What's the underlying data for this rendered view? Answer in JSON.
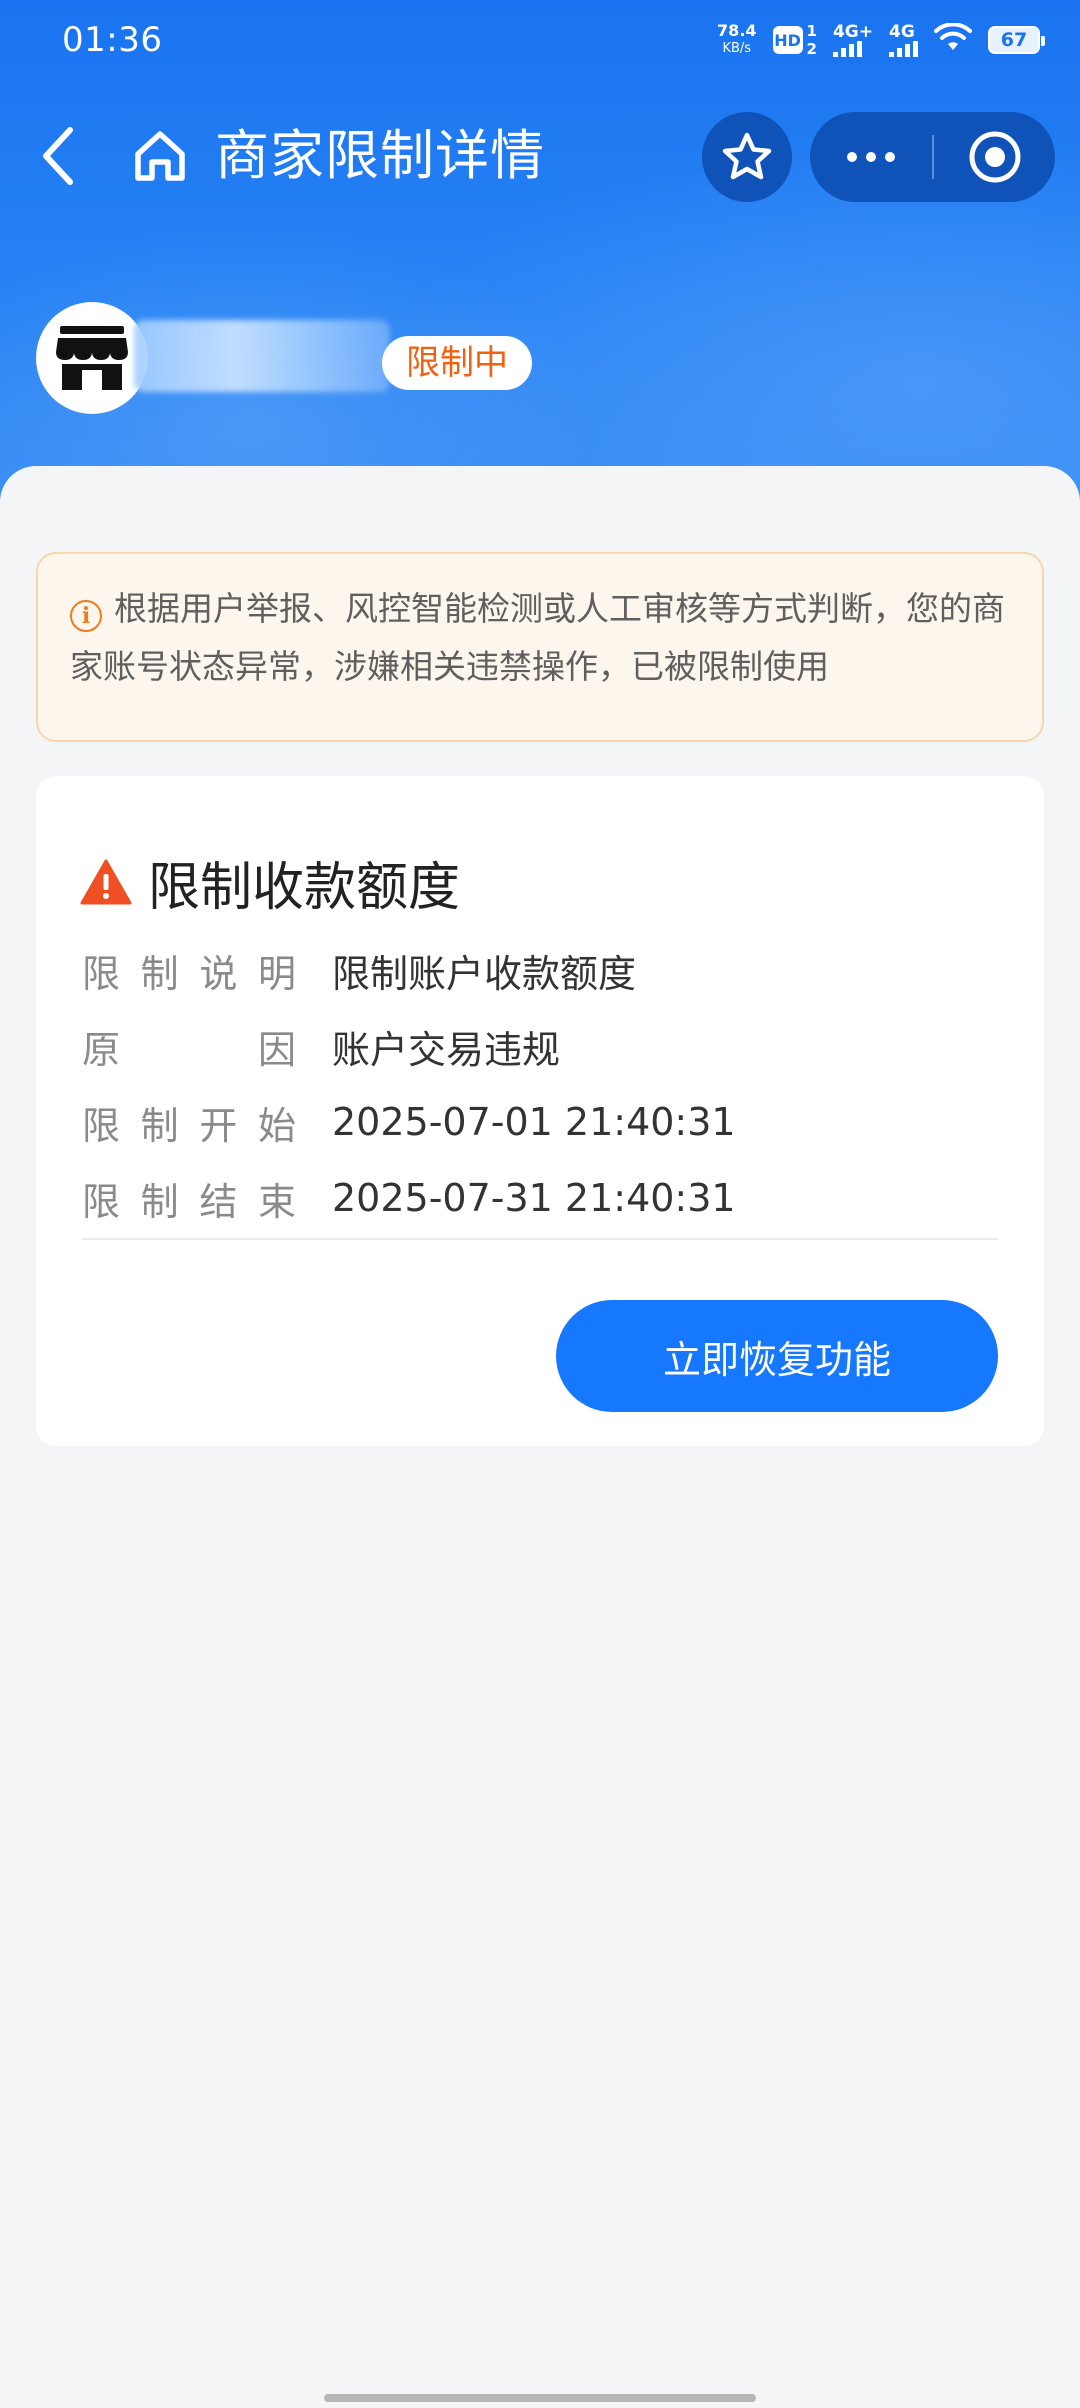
{
  "status_bar": {
    "time": "01:36",
    "net_speed": "78.4",
    "net_speed_unit": "KB/s",
    "hd": "HD",
    "hd_sim": "1",
    "hd_sim2": "2",
    "sig1": "4G+",
    "sig2": "4G",
    "battery": "67"
  },
  "nav": {
    "title": "商家限制详情"
  },
  "merchant": {
    "status": "限制中"
  },
  "notice": {
    "text": "根据用户举报、风控智能检测或人工审核等方式判断，您的商家账号状态异常，涉嫌相关违禁操作，已被限制使用"
  },
  "card": {
    "title": "限制收款额度",
    "rows": [
      {
        "label": [
          "限",
          "制",
          "说",
          "明"
        ],
        "value": "限制账户收款额度"
      },
      {
        "label": [
          "原",
          "因"
        ],
        "value": "账户交易违规"
      },
      {
        "label": [
          "限",
          "制",
          "开",
          "始"
        ],
        "value": "2025-07-01 21:40:31"
      },
      {
        "label": [
          "限",
          "制",
          "结",
          "束"
        ],
        "value": "2025-07-31 21:40:31"
      }
    ],
    "button": "立即恢复功能"
  },
  "colors": {
    "brand_blue": "#1677ff",
    "warning_orange": "#f06212",
    "notice_bg": "#fdf6ec"
  }
}
